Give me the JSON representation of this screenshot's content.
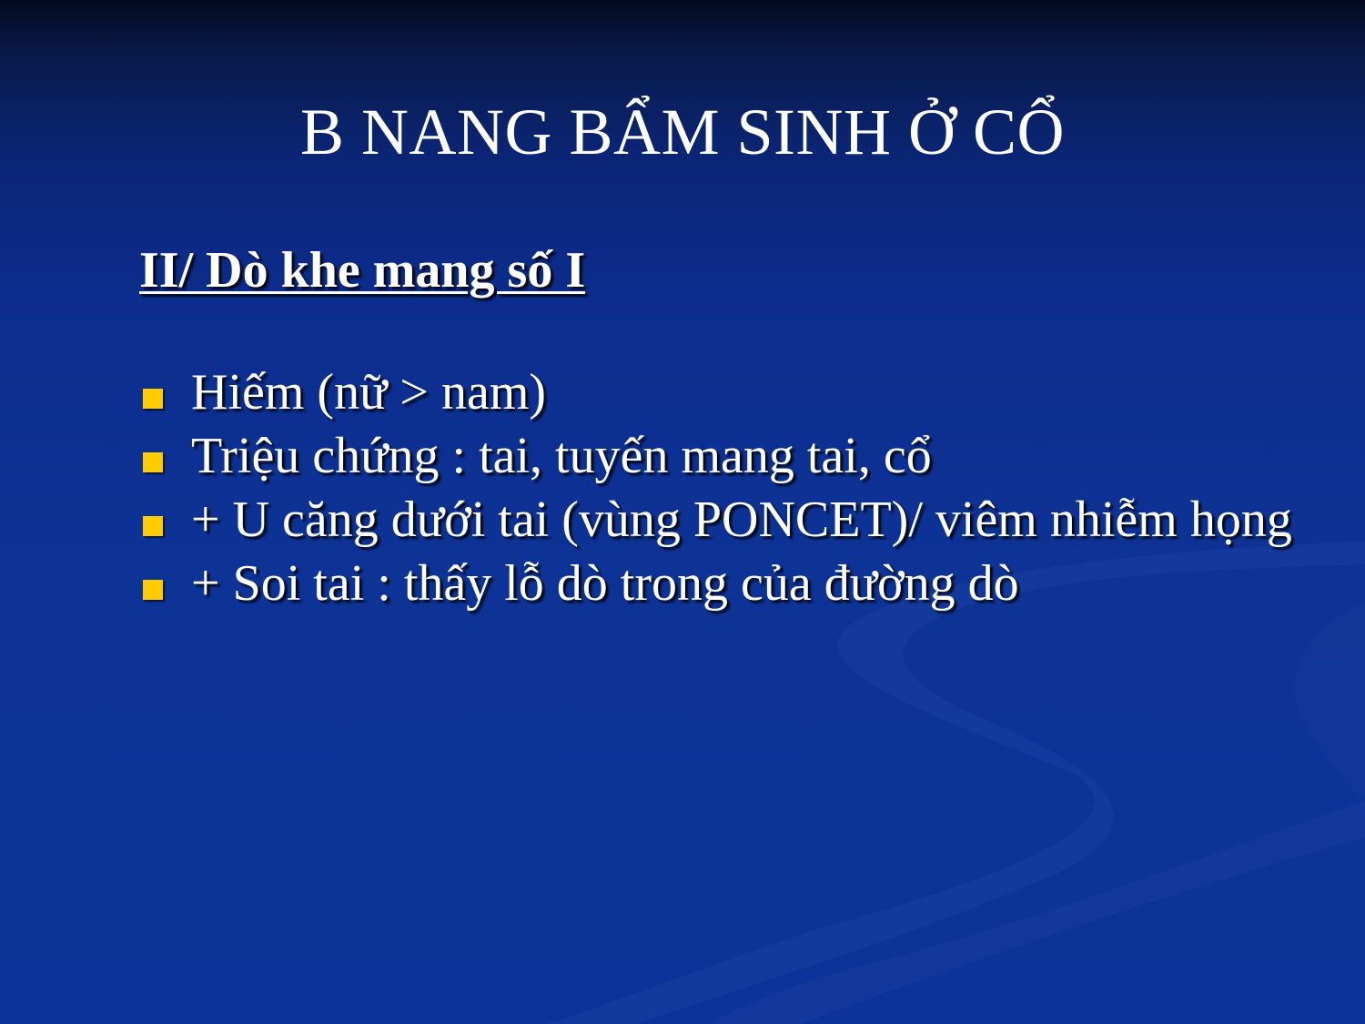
{
  "slide": {
    "title": "B NANG BẨM SINH Ở CỔ",
    "heading": "II/ Dò khe mang số I",
    "bullets": [
      {
        "text": "Hiếm (nữ > nam)"
      },
      {
        "text": "Triệu chứng : tai, tuyến mang tai, cổ"
      },
      {
        "text": "+ U căng dưới tai (vùng PONCET)/ viêm nhiễm họng"
      },
      {
        "text": "+ Soi tai : thấy lỗ dò trong của đường dò"
      }
    ]
  },
  "colors": {
    "background": "#0c3399",
    "text": "#ffffff",
    "bullet_marker": "#ffcc00"
  }
}
